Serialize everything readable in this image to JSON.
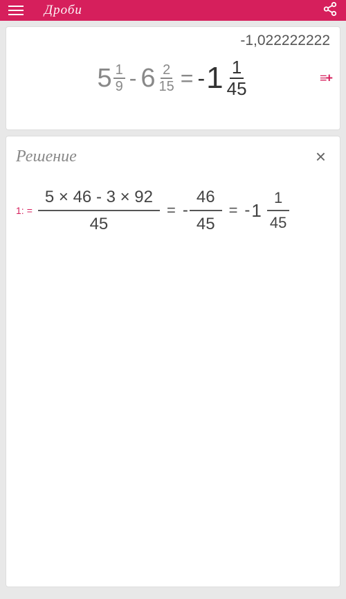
{
  "header": {
    "title": "Дроби"
  },
  "main": {
    "decimal": "-1,022222222",
    "term1": {
      "whole": "5",
      "num": "1",
      "den": "9"
    },
    "op1": "-",
    "term2": {
      "whole": "6",
      "num": "2",
      "den": "15"
    },
    "equals": "=",
    "resultSign": "-",
    "result": {
      "whole": "1",
      "num": "1",
      "den": "45"
    },
    "moreSymbol": "≡+"
  },
  "solution": {
    "title": "Решение",
    "close": "×",
    "step": {
      "label": "1:",
      "eq": "=",
      "frac1": {
        "num": "5 × 46 - 3 × 92",
        "den": "45"
      },
      "op2": "=",
      "neg2": "-",
      "frac2": {
        "num": "46",
        "den": "45"
      },
      "op3": "=",
      "neg3": "-",
      "mixed": {
        "whole": "1",
        "num": "1",
        "den": "45"
      }
    }
  }
}
